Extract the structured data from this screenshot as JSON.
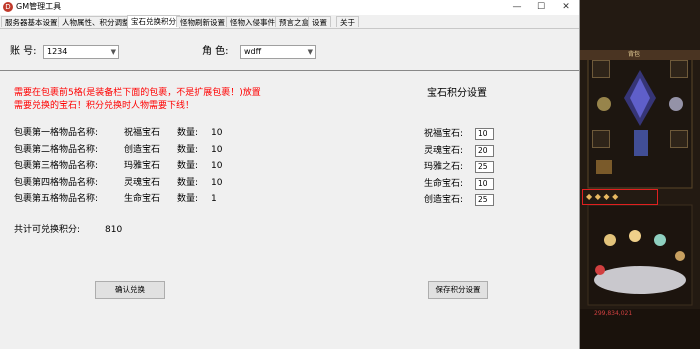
{
  "window": {
    "title": "GM管理工具",
    "minimize": "—",
    "maximize": "☐",
    "close": "✕"
  },
  "tabs": [
    {
      "label": "服务器基本设置"
    },
    {
      "label": "人物属性、积分调整"
    },
    {
      "label": "宝石兑换积分"
    },
    {
      "label": "怪物刷新设置"
    },
    {
      "label": "怪物入侵事件"
    },
    {
      "label": "预言之盒"
    },
    {
      "label": "设置"
    },
    {
      "label": "关于"
    }
  ],
  "active_tab": "宝石兑换积分",
  "account": {
    "label": "账  号:",
    "value": "1234"
  },
  "character": {
    "label": "角  色:",
    "value": "wdff"
  },
  "notice": {
    "line1": "需要在包裹前5格(是装备栏下面的包裹，不是扩展包裹！)放置",
    "line2": "需要兑换的宝石！积分兑换时人物需要下线！"
  },
  "items": [
    {
      "slot_label": "包裹第一格物品名称:",
      "item": "祝福宝石",
      "qty_label": "数量:",
      "qty": "10"
    },
    {
      "slot_label": "包裹第二格物品名称:",
      "item": "创造宝石",
      "qty_label": "数量:",
      "qty": "10"
    },
    {
      "slot_label": "包裹第三格物品名称:",
      "item": "玛雅宝石",
      "qty_label": "数量:",
      "qty": "10"
    },
    {
      "slot_label": "包裹第四格物品名称:",
      "item": "灵魂宝石",
      "qty_label": "数量:",
      "qty": "10"
    },
    {
      "slot_label": "包裹第五格物品名称:",
      "item": "生命宝石",
      "qty_label": "数量:",
      "qty": "1"
    }
  ],
  "total": {
    "label": "共计可兑换积分:",
    "value": "810"
  },
  "settings": {
    "title": "宝石积分设置",
    "rows": [
      {
        "label": "祝福宝石:",
        "value": "10"
      },
      {
        "label": "灵魂宝石:",
        "value": "20"
      },
      {
        "label": "玛雅之石:",
        "value": "25"
      },
      {
        "label": "生命宝石:",
        "value": "10"
      },
      {
        "label": "创造宝石:",
        "value": "25"
      }
    ]
  },
  "buttons": {
    "confirm": "确认兑换",
    "save": "保存积分设置"
  },
  "game": {
    "header": "背包",
    "gold": "299,834,021",
    "colors": {
      "highlight": "#e02020",
      "gold_text": "#d04040"
    }
  }
}
